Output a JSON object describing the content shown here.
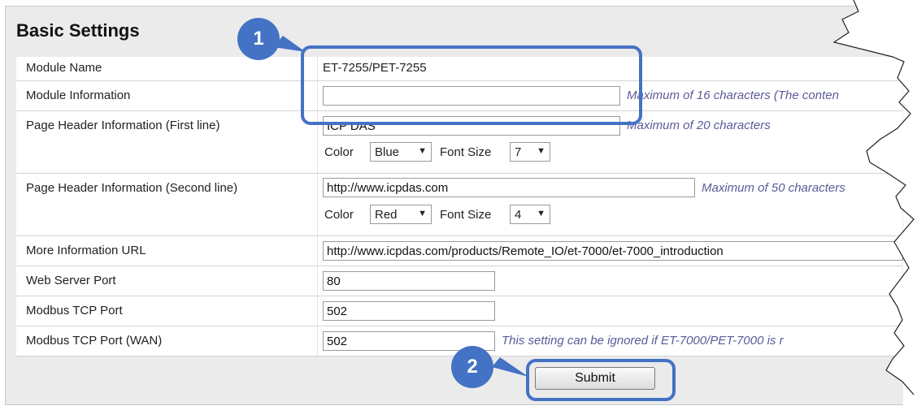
{
  "section_title": "Basic Settings",
  "rows": {
    "module_name": {
      "label": "Module Name",
      "value": "ET-7255/PET-7255"
    },
    "module_info": {
      "label": "Module Information",
      "value": "",
      "hint": "Maximum of 16 characters (The conten"
    },
    "header_first": {
      "label": "Page Header Information (First line)",
      "value": "ICP DAS",
      "hint": "Maximum of 20 characters",
      "color_label": "Color",
      "color_value": "Blue",
      "size_label": "Font Size",
      "size_value": "7"
    },
    "header_second": {
      "label": "Page Header Information (Second line)",
      "value": "http://www.icpdas.com",
      "hint": "Maximum of 50 characters",
      "color_label": "Color",
      "color_value": "Red",
      "size_label": "Font Size",
      "size_value": "4"
    },
    "more_info": {
      "label": "More Information URL",
      "value": "http://www.icpdas.com/products/Remote_IO/et-7000/et-7000_introduction"
    },
    "web_port": {
      "label": "Web Server Port",
      "value": "80"
    },
    "modbus_port": {
      "label": "Modbus TCP Port",
      "value": "502"
    },
    "modbus_wan": {
      "label": "Modbus TCP Port (WAN)",
      "value": "502",
      "hint": "This setting can be ignored if ET-7000/PET-7000 is r"
    }
  },
  "submit_label": "Submit",
  "callouts": {
    "one": "1",
    "two": "2"
  },
  "dropdown_arrow": "▼",
  "colors": {
    "callout": "#4472c4",
    "hint": "#5a5a9a",
    "panel": "#ebebeb"
  }
}
